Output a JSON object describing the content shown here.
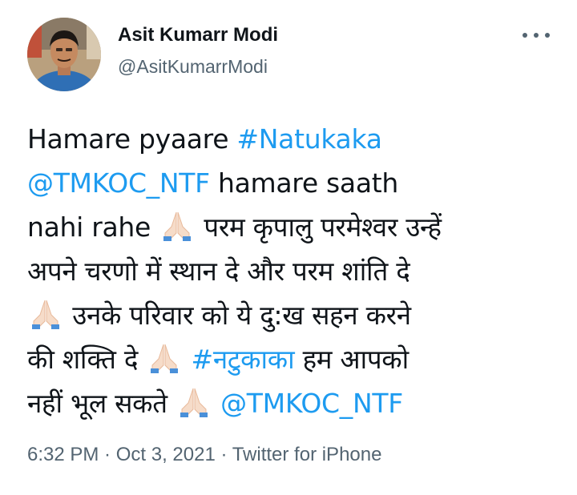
{
  "author": {
    "name": "Asit Kumarr Modi",
    "handle": "@AsitKumarrModi"
  },
  "more_icon": "more-horizontal-icon",
  "tweet": {
    "line1": {
      "t1": "Hamare pyaare ",
      "hashtag1": "#Natukaka"
    },
    "line2": {
      "mention1": "@TMKOC_NTF",
      "t2": " hamare saath"
    },
    "line3": {
      "t3": "nahi rahe ",
      "t4": " परम कृपालु परमेश्वर उन्हें"
    },
    "line4": {
      "t5": "अपने चरणो में स्थान दे और परम शांति दे"
    },
    "line5": {
      "t6": " उनके परिवार को ये दु:ख सहन करने"
    },
    "line6": {
      "t7": "की शक्ति दे ",
      "hashtag2": "#नटुकाका",
      "t8": " हम आपको"
    },
    "line7": {
      "t9": "नहीं भूल सकते ",
      "mention2": "@TMKOC_NTF"
    },
    "emoji": "folded-hands-emoji"
  },
  "meta": {
    "time": "6:32 PM",
    "sep1": " · ",
    "date": "Oct 3, 2021",
    "sep2": " · ",
    "source": "Twitter for iPhone"
  },
  "colors": {
    "link": "#1d9bf0",
    "text": "#0f1419",
    "secondary": "#536471"
  }
}
